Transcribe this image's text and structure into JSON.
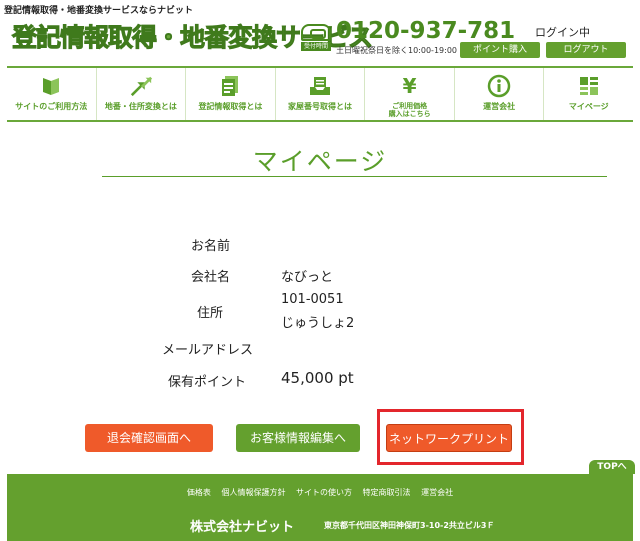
{
  "header": {
    "tagline": "登記情報取得・地番変換サービスならナビット",
    "logo": "登記情報取得・地番変換サービス",
    "phone_tag": "受付時間",
    "phone_number": "0120-937-781",
    "phone_hours": "土日曜祝祭日を除く10:00-19:00",
    "login_status": "ログイン中",
    "points_button": "ポイント購入",
    "logout_button": "ログアウト"
  },
  "nav": {
    "items": [
      {
        "label": "サイトのご利用方法",
        "icon": "book-icon"
      },
      {
        "label": "地番・住所変換とは",
        "icon": "arrows-icon"
      },
      {
        "label": "登記情報取得とは",
        "icon": "document-icon"
      },
      {
        "label": "家屋番号取得とは",
        "icon": "tray-icon"
      },
      {
        "label": "ご利用価格\n購入はこちら",
        "icon": "yen-icon",
        "symbol": "¥"
      },
      {
        "label": "運営会社",
        "icon": "info-icon",
        "symbol": "i"
      },
      {
        "label": "マイページ",
        "icon": "list-icon"
      }
    ]
  },
  "main": {
    "title": "マイページ",
    "fields": {
      "name_label": "お名前",
      "company_label": "会社名",
      "company_value": "なびっと",
      "address_label": "住所",
      "postal_code": "101-0051",
      "address_value": "じゅうしょ2",
      "email_label": "メールアドレス",
      "points_label": "保有ポイント",
      "points_value": "45,000 pt"
    },
    "buttons": {
      "withdraw": "退会確認画面へ",
      "edit": "お客様情報編集へ",
      "netprint": "ネットワークプリント"
    }
  },
  "top_link": "TOPへ",
  "footer": {
    "links": [
      "価格表",
      "個人情報保護方針",
      "サイトの使い方",
      "特定商取引法",
      "運営会社"
    ],
    "company": "株式会社ナビット",
    "address": "東京都千代田区神田神保町3-10-2共立ビル3Ｆ"
  },
  "colors": {
    "brand_green": "#64a02e",
    "accent_orange": "#ef5a2a",
    "highlight_red": "#e3262c"
  }
}
